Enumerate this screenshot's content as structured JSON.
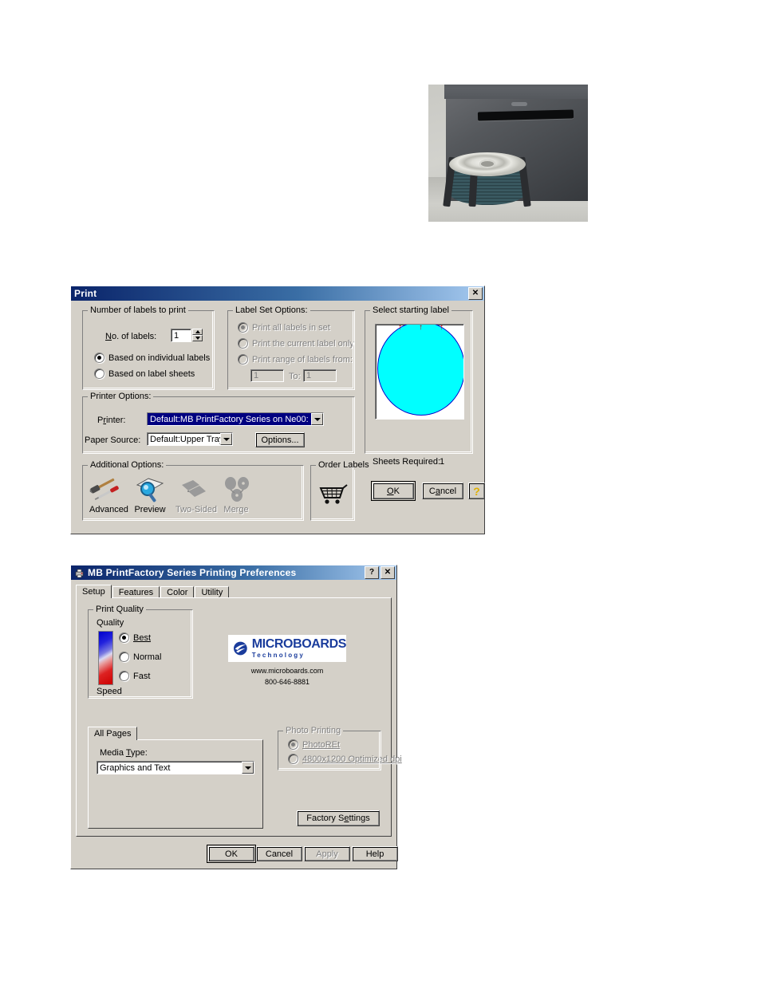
{
  "photo": {
    "alt": "disc publisher with stack of printable CDs in input bin"
  },
  "print_dialog": {
    "title": "Print",
    "close_label": "✕",
    "groups": {
      "number_of_labels": {
        "title": "Number of labels to print",
        "no_of_labels_label": "No. of labels:",
        "no_of_labels_value": "1",
        "radios": [
          {
            "label": "Based on individual labels",
            "selected": true
          },
          {
            "label": "Based on label sheets",
            "selected": false
          }
        ]
      },
      "label_set_options": {
        "title": "Label Set Options:",
        "disabled": true,
        "radios": [
          {
            "label": "Print all labels in set",
            "selected": true
          },
          {
            "label": "Print the current label only",
            "selected": false
          },
          {
            "label": "Print range of labels from:",
            "selected": false
          }
        ],
        "range_from_value": "1",
        "range_to_label": "To:",
        "range_to_value": "1"
      },
      "printer_options": {
        "title": "Printer Options:",
        "printer_label": "Printer:",
        "printer_value": "Default:MB PrintFactory Series on Ne00:",
        "paper_source_label": "Paper Source:",
        "paper_source_value": "Default:Upper Tray",
        "options_button": "Options..."
      },
      "additional_options": {
        "title": "Additional Options:",
        "items": [
          {
            "label": "Advanced",
            "icon": "hammer-screwdriver-icon",
            "enabled": true
          },
          {
            "label": "Preview",
            "icon": "magnifier-page-icon",
            "enabled": true
          },
          {
            "label": "Two-Sided",
            "icon": "two-pages-icon",
            "enabled": false
          },
          {
            "label": "Merge",
            "icon": "merge-shapes-icon",
            "enabled": false
          }
        ]
      },
      "order_labels": {
        "title": "Order Labels",
        "icon": "shopping-cart-icon"
      },
      "select_starting_label": {
        "title": "Select starting label",
        "circle_fill": "#00ffff",
        "circle_border": "#0000cc",
        "marker_glyph": "↑",
        "marker_color": "#cc0000",
        "marker_count": 3
      }
    },
    "sheets_required_label": "Sheets Required:",
    "sheets_required_value": "1",
    "buttons": {
      "ok": "OK",
      "cancel": "Cancel",
      "help_icon": "question-mark-help-icon",
      "help_glyph": "?"
    }
  },
  "preferences_dialog": {
    "title": "MB PrintFactory Series Printing Preferences",
    "icon": "printer-icon",
    "help_button": "?",
    "close_button": "✕",
    "tabs": [
      {
        "label": "Setup",
        "active": true
      },
      {
        "label": "Features",
        "active": false
      },
      {
        "label": "Color",
        "active": false
      },
      {
        "label": "Utility",
        "active": false
      }
    ],
    "print_quality": {
      "title": "Print Quality",
      "quality_label": "Quality",
      "speed_label": "Speed",
      "options": [
        {
          "label": "Best",
          "selected": true
        },
        {
          "label": "Normal",
          "selected": false
        },
        {
          "label": "Fast",
          "selected": false
        }
      ]
    },
    "branding": {
      "logo_primary": "MICROBOARDS",
      "logo_secondary": "Technology",
      "website": "www.microboards.com",
      "phone": "800-646-8881",
      "logo_color": "#1a3c9c"
    },
    "inner_tabs": [
      {
        "label": "All Pages",
        "active": true
      }
    ],
    "media": {
      "media_type_label": "Media Type:",
      "media_type_value": "Graphics and Text"
    },
    "photo_printing": {
      "title": "Photo Printing",
      "disabled": true,
      "options": [
        {
          "label": "PhotoREt",
          "selected": true
        },
        {
          "label": "4800x1200 Optimized dpi",
          "selected": false
        }
      ]
    },
    "factory_settings_button": "Factory Settings",
    "buttons": [
      {
        "label": "OK",
        "enabled": true,
        "default": true
      },
      {
        "label": "Cancel",
        "enabled": true,
        "default": false
      },
      {
        "label": "Apply",
        "enabled": false,
        "default": false
      },
      {
        "label": "Help",
        "enabled": true,
        "default": false
      }
    ]
  }
}
